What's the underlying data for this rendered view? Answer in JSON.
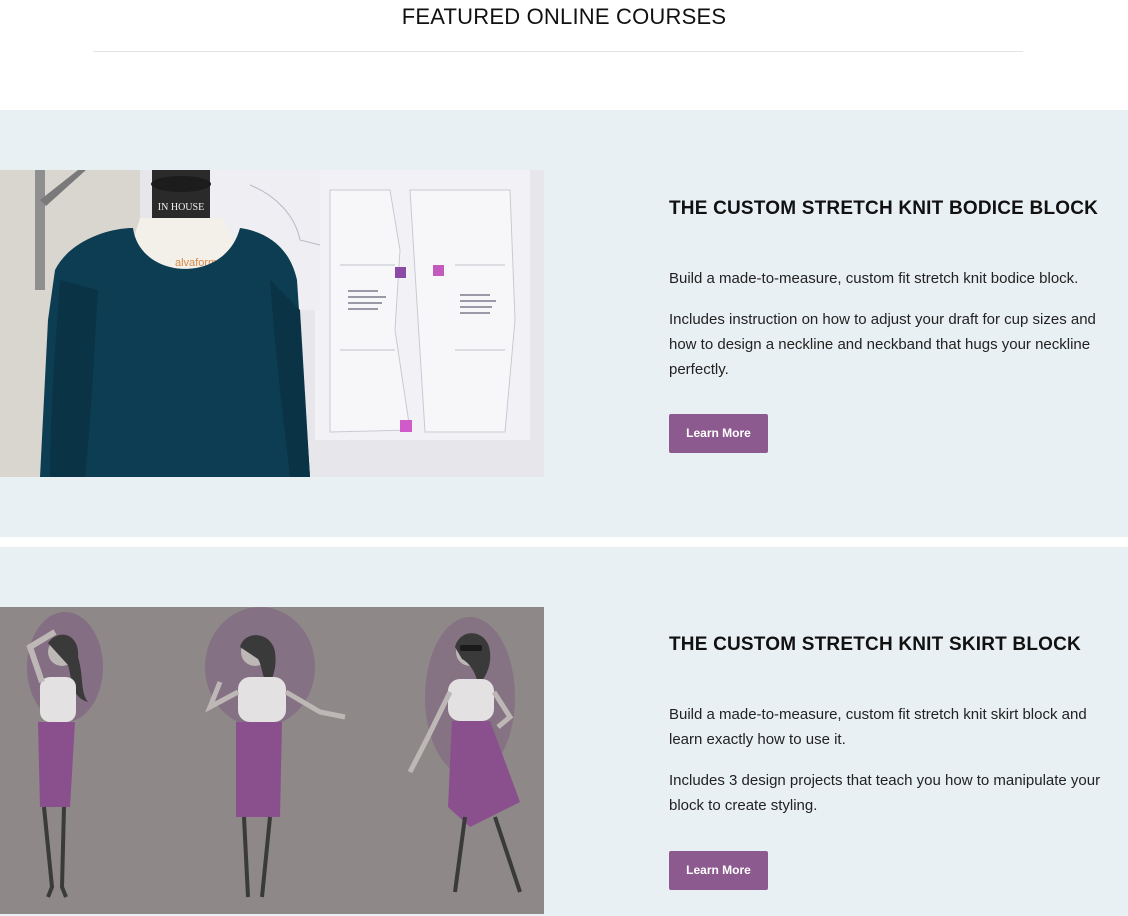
{
  "section": {
    "title": "FEATURED ONLINE COURSES"
  },
  "courses": [
    {
      "title": "THE CUSTOM STRETCH KNIT BODICE BLOCK",
      "paragraphs": [
        "Build a made-to-measure, custom fit stretch knit bodice block.",
        "Includes instruction on how to adjust your draft for cup sizes and how to design a neckline and neckband that hugs your neckline perfectly."
      ],
      "button_label": "Learn More",
      "image_label": "IN HOUSE",
      "image_sublabel": "alvaform"
    },
    {
      "title": "THE CUSTOM STRETCH KNIT SKIRT BLOCK",
      "paragraphs": [
        "Build a made-to-measure, custom fit stretch knit skirt block and learn exactly how to use it.",
        "Includes 3 design projects that teach you how to manipulate your block to create styling."
      ],
      "button_label": "Learn More"
    }
  ],
  "colors": {
    "section_bg": "#e9f0f3",
    "button": "#8c5a8e",
    "accent_purple": "#7e3f80"
  }
}
